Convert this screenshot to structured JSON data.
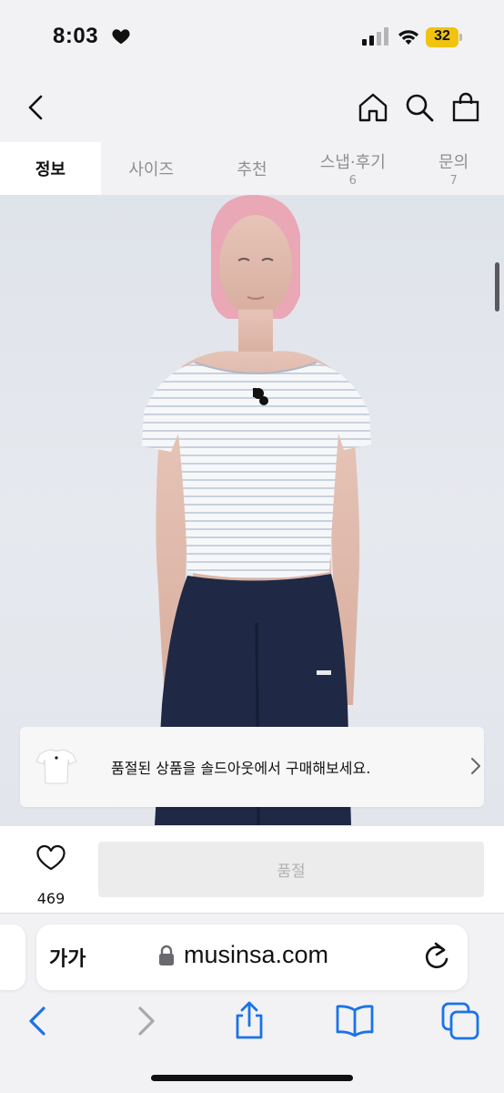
{
  "status": {
    "time": "8:03",
    "battery": "32"
  },
  "tabs": [
    {
      "label": "정보",
      "count": ""
    },
    {
      "label": "사이즈",
      "count": ""
    },
    {
      "label": "추천",
      "count": ""
    },
    {
      "label": "스냅·후기",
      "count": "6"
    },
    {
      "label": "문의",
      "count": "7"
    }
  ],
  "banner": {
    "text": "품절된 상품을 솔드아웃에서 구매해보세요."
  },
  "buybar": {
    "likes": "469",
    "button_label": "품절"
  },
  "browser": {
    "reader_label": "가가",
    "url": "musinsa.com"
  },
  "colors": {
    "accent": "#1a73e8",
    "soldout_bg": "#ececec",
    "active_tab_bg": "#ffffff"
  },
  "icons": [
    "heart-icon",
    "signal-icon",
    "wifi-icon",
    "battery-icon",
    "back-icon",
    "home-icon",
    "search-icon",
    "shopping-bag-icon",
    "chevron-right-icon",
    "like-heart-icon",
    "lock-icon",
    "reload-icon",
    "safari-back-icon",
    "safari-forward-icon",
    "share-icon",
    "bookmarks-icon",
    "tabs-icon"
  ]
}
